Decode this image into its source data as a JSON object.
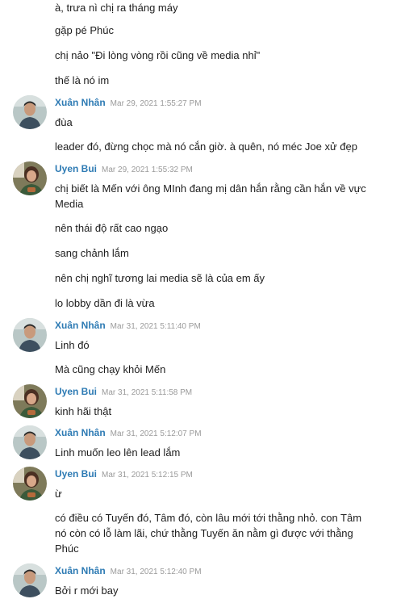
{
  "messages": [
    {
      "text": "à, trưa nì chị ra tháng máy"
    },
    {
      "text": "gặp pé Phúc"
    },
    {
      "text": "chị nảo \"Đi lòng vòng rồi cũng về media nhỉ\""
    },
    {
      "text": "thế là nó im"
    },
    {
      "sender": "Xuân Nhân",
      "time": "Mar 29, 2021 1:55:27 PM",
      "text": "đùa"
    },
    {
      "text": "leader đó, đừng chọc mà nó cắn giờ. à quên, nó méc Joe xử đẹp"
    },
    {
      "sender": "Uyen Bui",
      "time": "Mar 29, 2021 1:55:32 PM",
      "text": "chị biết là Mến với ông MInh đang mị dân hắn rằng cần hắn về vực Media"
    },
    {
      "text": "nên thái độ rất cao ngạo"
    },
    {
      "text": "sang chảnh lắm"
    },
    {
      "text": "nên chị nghĩ tương lai media sẽ là của em ấy"
    },
    {
      "text": "lo lobby dần đi là vừa"
    },
    {
      "sender": "Xuân Nhân",
      "time": "Mar 31, 2021 5:11:40 PM",
      "text": "Linh đó"
    },
    {
      "text": "Mà cũng chạy khỏi Mến"
    },
    {
      "sender": "Uyen Bui",
      "time": "Mar 31, 2021 5:11:58 PM",
      "text": "kinh hãi thật"
    },
    {
      "sender": "Xuân Nhân",
      "time": "Mar 31, 2021 5:12:07 PM",
      "text": "Linh muốn leo lên lead lắm"
    },
    {
      "sender": "Uyen Bui",
      "time": "Mar 31, 2021 5:12:15 PM",
      "text": "ừ"
    },
    {
      "text": "có điều có Tuyến đó, Tâm đó, còn lâu mới tới thằng nhỏ. con Tâm nó còn có lỗ làm lãi, chứ thằng Tuyến ăn nằm gì được với thằng Phúc"
    },
    {
      "sender": "Xuân Nhân",
      "time": "Mar 31, 2021 5:12:40 PM",
      "text": "Bởi r mới bay"
    }
  ]
}
